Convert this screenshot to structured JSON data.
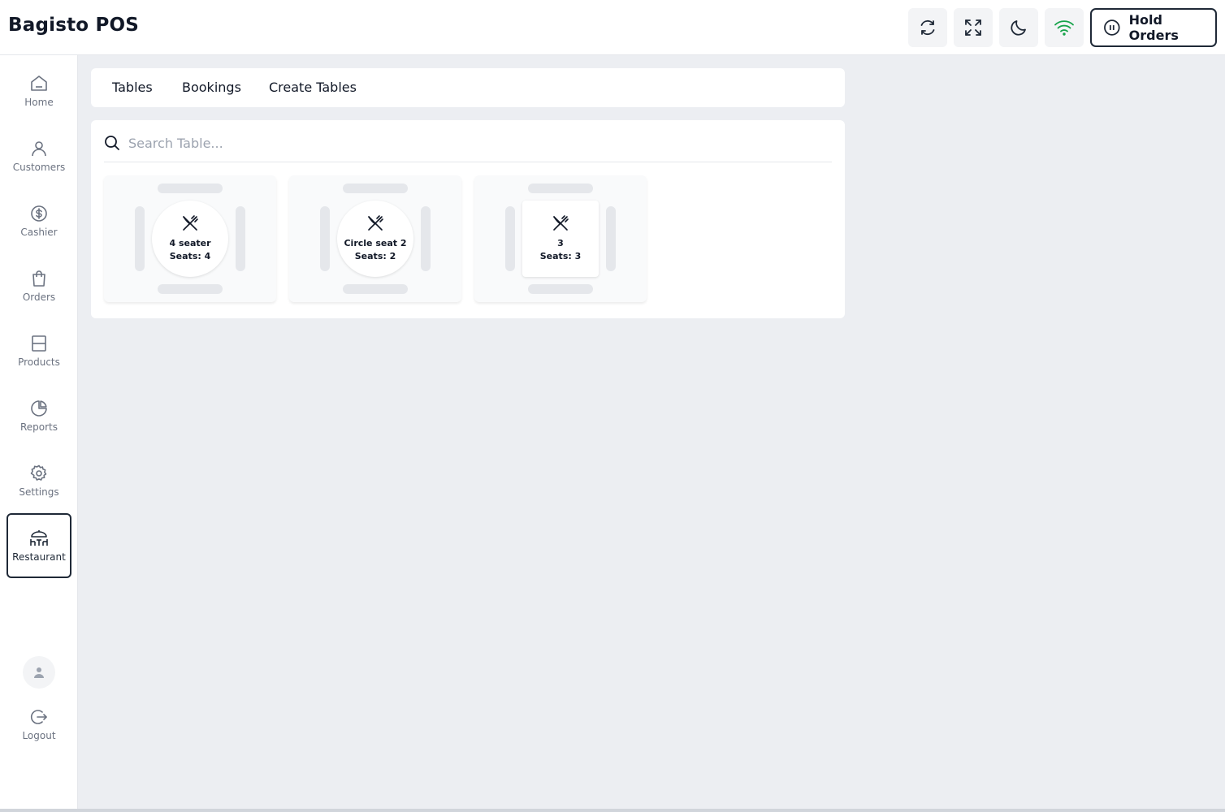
{
  "app": {
    "title": "Bagisto POS"
  },
  "header": {
    "hold_orders_label": "Hold Orders",
    "wifi_color": "#16a34a"
  },
  "sidebar": {
    "items": [
      {
        "label": "Home",
        "icon": "home-icon"
      },
      {
        "label": "Customers",
        "icon": "user-icon"
      },
      {
        "label": "Cashier",
        "icon": "dollar-circle-icon"
      },
      {
        "label": "Orders",
        "icon": "shopping-bag-icon"
      },
      {
        "label": "Products",
        "icon": "archive-box-icon"
      },
      {
        "label": "Reports",
        "icon": "pie-chart-icon"
      },
      {
        "label": "Settings",
        "icon": "gear-icon"
      },
      {
        "label": "Restaurant",
        "icon": "restaurant-table-icon",
        "active": true
      }
    ],
    "logout_label": "Logout"
  },
  "tabs": [
    {
      "label": "Tables"
    },
    {
      "label": "Bookings"
    },
    {
      "label": "Create Tables"
    }
  ],
  "search": {
    "placeholder": "Search Table..."
  },
  "tables": [
    {
      "name": "4 seater",
      "seats_text": "Seats: 4",
      "shape": "circle"
    },
    {
      "name": "Circle seat 2",
      "seats_text": "Seats: 2",
      "shape": "circle"
    },
    {
      "name": "3",
      "seats_text": "Seats: 3",
      "shape": "square"
    }
  ]
}
